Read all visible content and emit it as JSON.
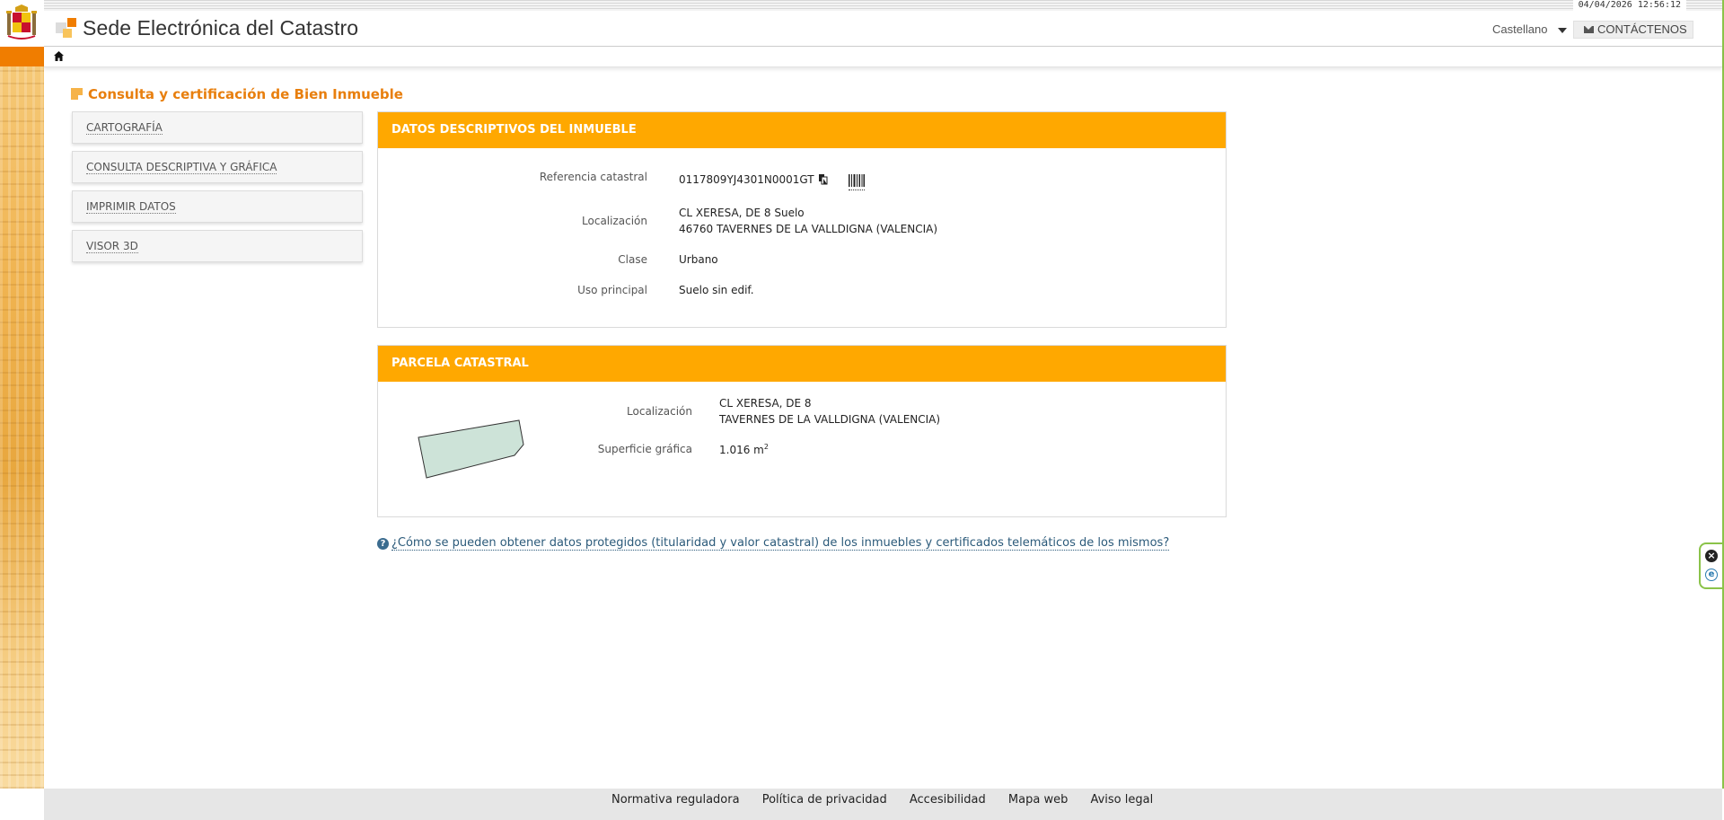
{
  "header": {
    "datetime": "04/04/2026  12:56:12",
    "site_title": "Sede Electrónica del Catastro",
    "language": "Castellano",
    "contact_label": "CONTÁCTENOS"
  },
  "page_heading": "Consulta y certificación de Bien Inmueble",
  "menu": [
    {
      "label": "CARTOGRAFÍA"
    },
    {
      "label": "CONSULTA DESCRIPTIVA Y GRÁFICA"
    },
    {
      "label": "IMPRIMIR DATOS"
    },
    {
      "label": "VISOR 3D"
    }
  ],
  "datos": {
    "title": "DATOS DESCRIPTIVOS DEL INMUEBLE",
    "ref_label": "Referencia catastral",
    "ref_value": "0117809YJ4301N0001GT",
    "loc_label": "Localización",
    "loc_line1": "CL XERESA, DE 8 Suelo",
    "loc_line2": "46760 TAVERNES DE LA VALLDIGNA (VALENCIA)",
    "clase_label": "Clase",
    "clase_value": "Urbano",
    "uso_label": "Uso principal",
    "uso_value": "Suelo sin edif."
  },
  "parcela": {
    "title": "PARCELA CATASTRAL",
    "loc_label": "Localización",
    "loc_line1": "CL XERESA, DE 8",
    "loc_line2": "TAVERNES DE LA VALLDIGNA (VALENCIA)",
    "sup_label": "Superficie gráfica",
    "sup_value": "1.016 m",
    "sup_unit_sup": "2"
  },
  "help_link": "¿Cómo se pueden obtener datos protegidos (titularidad y valor catastral) de los inmuebles y certificados telemáticos de los mismos?",
  "footer": [
    {
      "label": "Normativa reguladora"
    },
    {
      "label": "Política de privacidad"
    },
    {
      "label": "Accesibilidad"
    },
    {
      "label": "Mapa web"
    },
    {
      "label": "Aviso legal"
    }
  ],
  "colors": {
    "accent_orange": "#ffa800",
    "heading_orange": "#e87f0e",
    "parcel_fill": "#cde3d8"
  }
}
